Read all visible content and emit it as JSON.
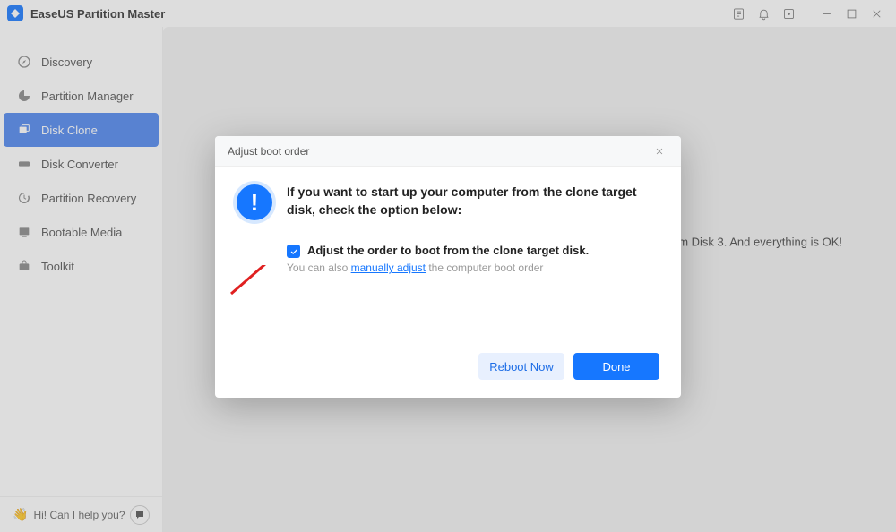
{
  "title": "EaseUS Partition Master",
  "sidebar": {
    "items": [
      {
        "label": "Discovery"
      },
      {
        "label": "Partition Manager"
      },
      {
        "label": "Disk Clone"
      },
      {
        "label": "Disk Converter"
      },
      {
        "label": "Partition Recovery"
      },
      {
        "label": "Bootable Media"
      },
      {
        "label": "Toolkit"
      }
    ]
  },
  "help": {
    "text": "Hi! Can I help you?"
  },
  "main": {
    "bg_text": "rom Disk 3. And everything is OK!"
  },
  "dialog": {
    "title": "Adjust boot order",
    "heading": "If you want to start up your computer from the clone target disk, check the option below:",
    "checkbox_label": "Adjust the order to boot from the clone target disk.",
    "hint_pre": "You can also ",
    "hint_link": "manually adjust",
    "hint_post": " the computer boot order",
    "btn_secondary": "Reboot Now",
    "btn_primary": "Done"
  }
}
